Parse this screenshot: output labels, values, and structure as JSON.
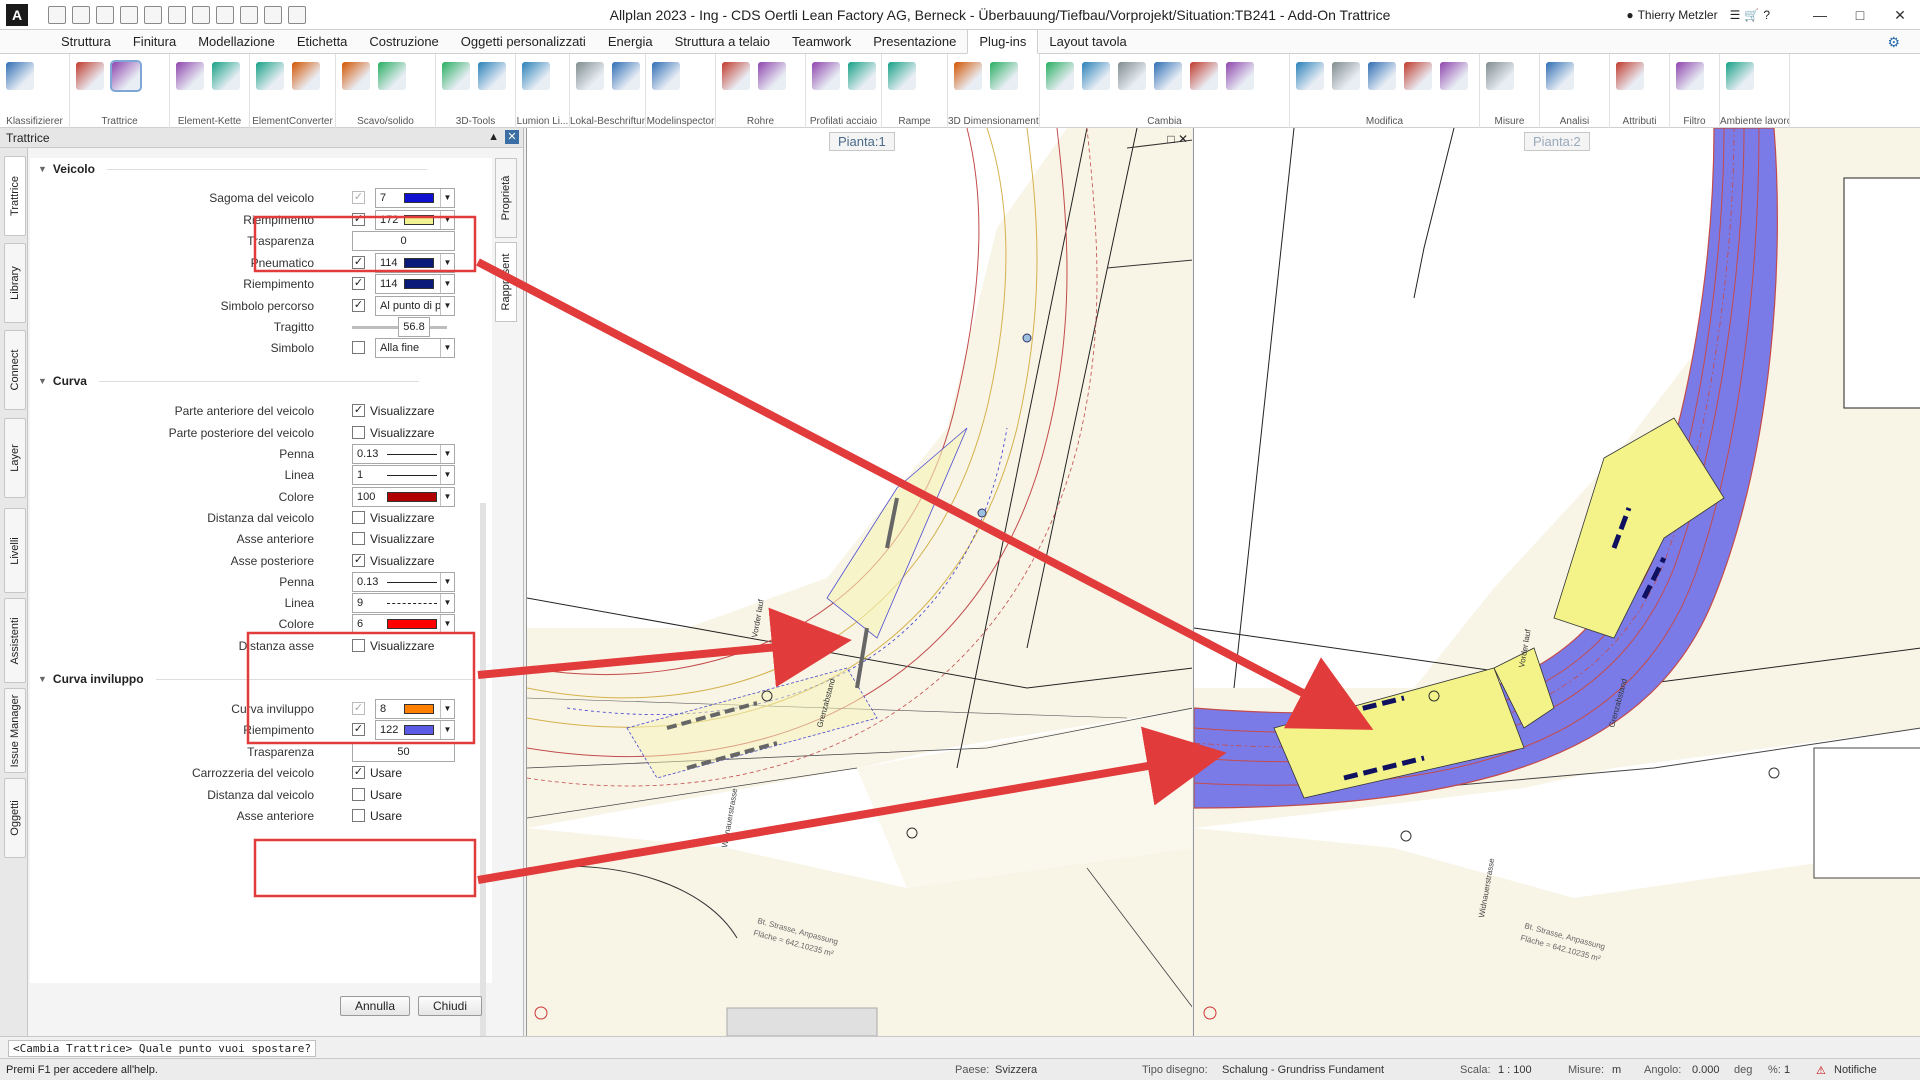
{
  "app": {
    "title": "Allplan 2023 - Ing - CDS Oertli Lean Factory AG, Berneck - Überbauung/Tiefbau/Vorprojekt/Situation:TB241 - Add-On Trattrice",
    "user": "Thierry Metzler",
    "logo": "A"
  },
  "ribbon_tabs": [
    "Struttura",
    "Finitura",
    "Modellazione",
    "Etichetta",
    "Costruzione",
    "Oggetti personalizzati",
    "Energia",
    "Struttura a telaio",
    "Teamwork",
    "Presentazione",
    "Plug-ins",
    "Layout tavola"
  ],
  "active_tab": "Plug-ins",
  "ribbon_groups": [
    "Klassifizierer",
    "Trattrice",
    "Element-Kette",
    "ElementConverter",
    "Scavo/solido",
    "3D-Tools",
    "Lumion Li...",
    "Lokal-Beschriftung",
    "Modelinspector",
    "Rohre",
    "Profilati acciaio",
    "Rampe",
    "3D Dimensionamento",
    "Cambia",
    "Modifica",
    "Misure",
    "Analisi",
    "Attributi",
    "Filtro",
    "Ambiente lavoro"
  ],
  "panel": {
    "title": "Trattrice",
    "left_tabs": [
      "Trattrice",
      "Library",
      "Connect",
      "Layer",
      "Livelli",
      "Assistenti",
      "Issue Manager",
      "Oggetti"
    ],
    "right_tabs": [
      "Proprietà",
      "Rappresent"
    ],
    "sections": {
      "veicolo": "Veicolo",
      "curva": "Curva",
      "inviluppo": "Curva inviluppo"
    },
    "rows": {
      "sagoma": {
        "label": "Sagoma del veicolo",
        "num": "7",
        "color": "#1010d0"
      },
      "riemp1": {
        "label": "Riempimento",
        "num": "172",
        "color": "#f2f291"
      },
      "trasp1": {
        "label": "Trasparenza",
        "value": "0"
      },
      "pneumatico": {
        "label": "Pneumatico",
        "num": "114",
        "color": "#0a1a78"
      },
      "riemp2": {
        "label": "Riempimento",
        "num": "114",
        "color": "#0a1a78"
      },
      "simbolo_percorso": {
        "label": "Simbolo percorso",
        "value": "Al punto di p"
      },
      "tragitto": {
        "label": "Tragitto",
        "value": "56.8"
      },
      "simbolo": {
        "label": "Simbolo",
        "value": "Alla fine"
      },
      "parte_ant": {
        "label": "Parte anteriore del veicolo",
        "check": "Visualizzare"
      },
      "parte_post": {
        "label": "Parte posteriore del veicolo",
        "check": "Visualizzare"
      },
      "penna1": {
        "label": "Penna",
        "value": "0.13"
      },
      "linea1": {
        "label": "Linea",
        "value": "1"
      },
      "colore1": {
        "label": "Colore",
        "num": "100",
        "color": "#b00000"
      },
      "dist_veicolo": {
        "label": "Distanza dal veicolo",
        "check": "Visualizzare"
      },
      "asse_ant": {
        "label": "Asse anteriore",
        "check": "Visualizzare"
      },
      "asse_post": {
        "label": "Asse posteriore",
        "check": "Visualizzare"
      },
      "penna2": {
        "label": "Penna",
        "value": "0.13"
      },
      "linea2": {
        "label": "Linea",
        "value": "9"
      },
      "colore2": {
        "label": "Colore",
        "num": "6",
        "color": "#ff0000"
      },
      "dist_asse": {
        "label": "Distanza asse",
        "check": "Visualizzare"
      },
      "curva_inv": {
        "label": "Curva inviluppo",
        "num": "8",
        "color": "#ff8000"
      },
      "riemp3": {
        "label": "Riempimento",
        "num": "122",
        "color": "#5a5ae6"
      },
      "trasp2": {
        "label": "Trasparenza",
        "value": "50"
      },
      "carrozzeria": {
        "label": "Carrozzeria del veicolo",
        "check": "Usare"
      },
      "dist_veicolo2": {
        "label": "Distanza dal veicolo",
        "check": "Usare"
      },
      "asse_ant2": {
        "label": "Asse anteriore",
        "check": "Usare"
      }
    },
    "buttons": {
      "cancel": "Annulla",
      "close": "Chiudi"
    }
  },
  "viewports": {
    "left": {
      "label": "Pianta:1"
    },
    "right": {
      "label": "Pianta:2"
    },
    "map_labels": {
      "road": "Widnauerstrasse",
      "area": "Bt. Strasse, Anpassung",
      "area2": "Fläche = 642.10235 m²",
      "grenz": "Grenzabstand",
      "vorder": "Vorder lauf"
    }
  },
  "command_prompt": "<Cambia Trattrice> Quale punto vuoi spostare?",
  "status": {
    "help": "Premi F1 per accedere all'help.",
    "paese_label": "Paese:",
    "paese": "Svizzera",
    "tipo_label": "Tipo disegno:",
    "tipo": "Schalung - Grundriss Fundament",
    "scala_label": "Scala:",
    "scala": "1 : 100",
    "misure_label": "Misure:",
    "misure": "m",
    "angolo_label": "Angolo:",
    "angolo": "0.000",
    "deg": "deg",
    "pct_label": "%:",
    "pct": "1",
    "notifiche": "Notifiche"
  },
  "colors": {
    "annotation_red": "#e23b3b",
    "envelope_fill": "#7b7be8",
    "vehicle_fill": "#f3f38a",
    "plan_beige": "#f8f4e6"
  }
}
